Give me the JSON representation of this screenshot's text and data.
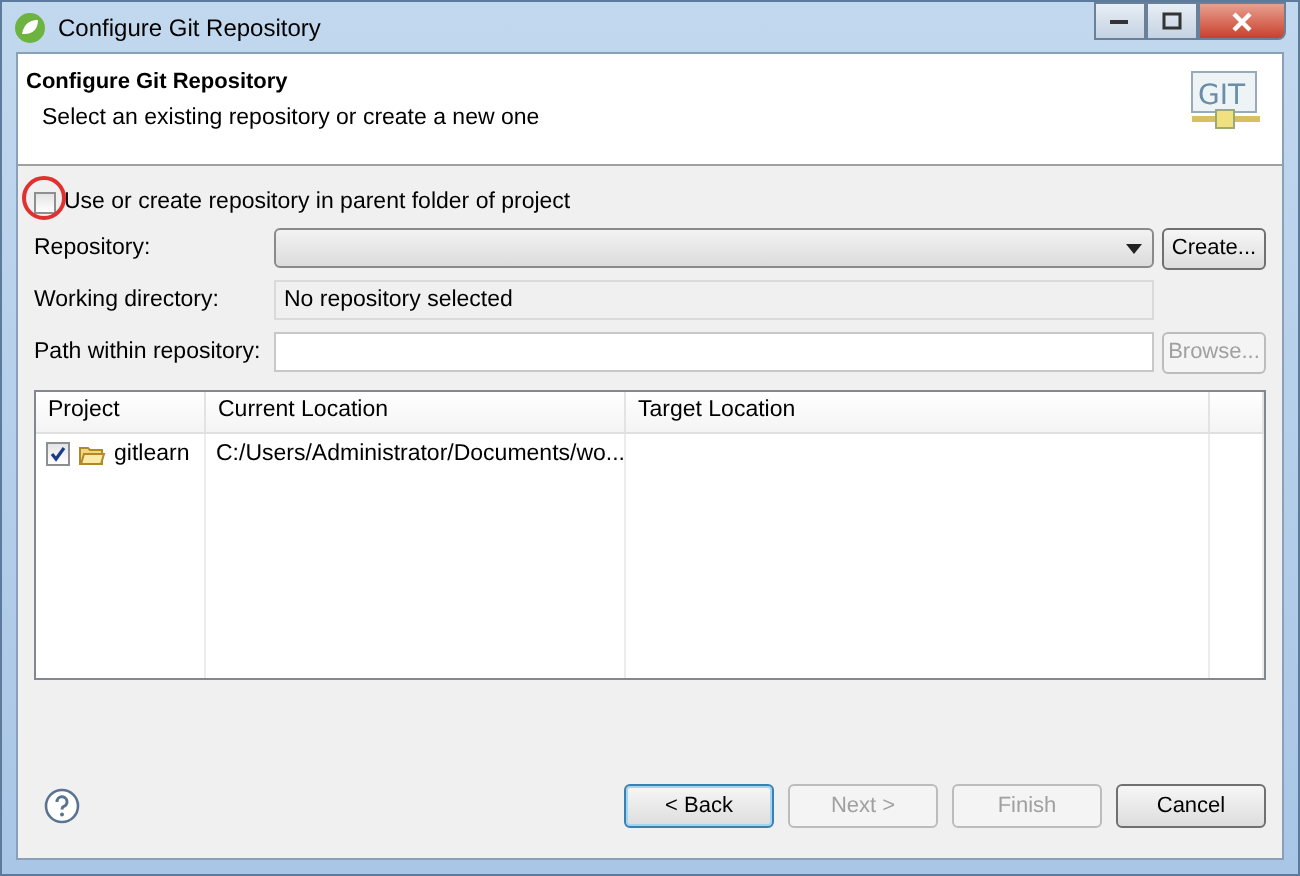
{
  "window": {
    "title": "Configure Git Repository"
  },
  "header": {
    "title": "Configure Git Repository",
    "description": "Select an existing repository or create a new one",
    "logo_text": "GIT"
  },
  "parent_folder_option": {
    "label": "Use or create repository in parent folder of project",
    "checked": false
  },
  "repository": {
    "label": "Repository:",
    "button": "Create..."
  },
  "working_directory": {
    "label": "Working directory:",
    "value": "No repository selected"
  },
  "path_within": {
    "label": "Path within repository:",
    "button": "Browse...",
    "button_disabled": true
  },
  "table": {
    "columns": [
      "Project",
      "Current Location",
      "Target Location"
    ],
    "rows": [
      {
        "project": "gitlearn",
        "checked": true,
        "current_location": "C:/Users/Administrator/Documents/wo..."
      }
    ]
  },
  "buttons": [
    {
      "label": "< Back",
      "disabled": false,
      "default": true
    },
    {
      "label": "Next >",
      "disabled": true,
      "default": false
    },
    {
      "label": "Finish",
      "disabled": true,
      "default": false
    },
    {
      "label": "Cancel",
      "disabled": false,
      "default": false
    }
  ]
}
